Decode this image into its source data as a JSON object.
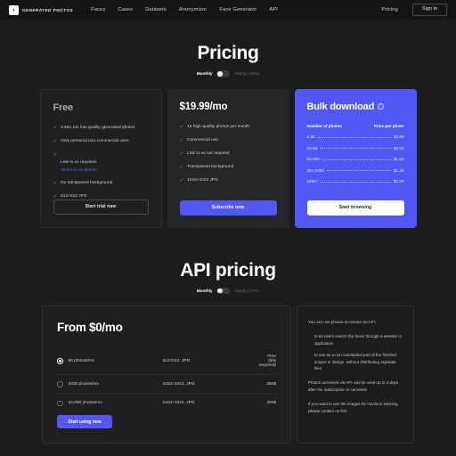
{
  "nav": {
    "brand": "GENERATED PHOTOS",
    "brand_glyph": "›",
    "links": [
      "Faces",
      "Cases",
      "Datasets",
      "Anonymizer",
      "Face Generator",
      "API"
    ],
    "pricing": "Pricing",
    "signin": "Sign in"
  },
  "pricing": {
    "title": "Pricing",
    "toggle": {
      "monthly": "Monthly",
      "yearly": "Yearly (-22%)"
    },
    "free": {
      "title": "Free",
      "features": [
        "2,681,111 low-quality generated photos",
        "Only personal non-commercial uses",
        "Link to us required.",
        "No transparent background",
        "512×512 JPG"
      ],
      "terms_link": "Terms & conditions",
      "button": "Start trial now"
    },
    "pro": {
      "price": "$19.99/mo",
      "features": [
        "15 high-quality photos per month",
        "Commercial use",
        "Link to us not required",
        "Transparent background",
        "1024×1024 JPG"
      ],
      "button": "Subscribe now"
    },
    "bulk": {
      "title": "Bulk download",
      "info_glyph": "ⓘ",
      "col_photos": "Number of photos",
      "col_price": "Price per photo",
      "rows": [
        {
          "range": "1-20",
          "price": "$2.99"
        },
        {
          "range": "21-50",
          "price": "$2.00"
        },
        {
          "range": "51-250",
          "price": "$1.50"
        },
        {
          "range": "251-1000",
          "price": "$1.25"
        },
        {
          "range": "1000+",
          "price": "$1.00"
        }
      ],
      "button": "Start browsing"
    }
  },
  "api": {
    "title": "API pricing",
    "toggle": {
      "monthly": "Monthly",
      "yearly": "Yearly (-17%)"
    },
    "price": "From $0/mo",
    "rows": [
      {
        "plan": "50 photos/mo",
        "size": "512×512, JPG",
        "cost": "Free (link required)",
        "selected": true
      },
      {
        "plan": "1000 photos/mo",
        "size": "1024×1024, JPG",
        "cost": "250$",
        "selected": false
      },
      {
        "plan": "10,000 photos/mo",
        "size": "1024×1024, JPG",
        "cost": "300$",
        "selected": false
      }
    ],
    "button": "Start using now",
    "note": {
      "intro": "You can use photos accessed via API:",
      "bullets": [
        "to let users search the faces through a website or application",
        "to use as a non-substantial part of the finished project or design, without distributing separate files"
      ],
      "para2": "Photos accessed via API can be used up to 3 days after the subscription is canceled.",
      "para3": "If you want to use the images for machine learning, please contact us first"
    }
  },
  "colors": {
    "accent": "#4f58f5",
    "link": "#5865f2",
    "check": "#3ec46d",
    "bg": "#1c1c1c"
  }
}
